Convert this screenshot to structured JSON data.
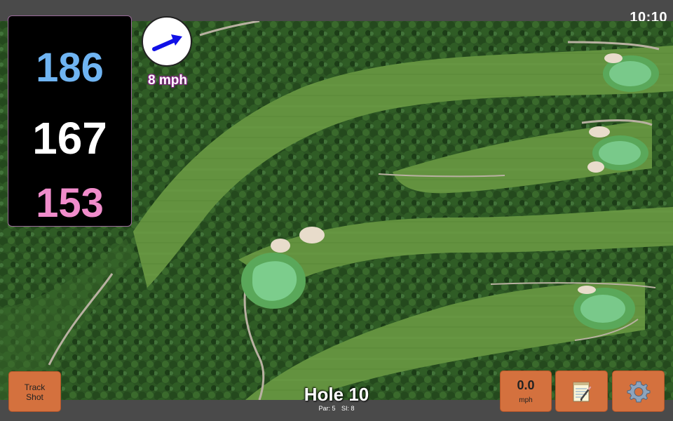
{
  "status": {
    "time": "10:10"
  },
  "distances": {
    "back": "186",
    "middle": "167",
    "front": "153"
  },
  "wind": {
    "speed_label": "8 mph",
    "icon": "wind-arrow-icon",
    "arrow_color": "#1010e6"
  },
  "buttons": {
    "track_shot_line1": "Track",
    "track_shot_line2": "Shot",
    "wind_value": "0.0",
    "wind_unit": "mph",
    "notes_icon": "notepad-icon",
    "settings_icon": "gear-icon"
  },
  "hole": {
    "title": "Hole 10",
    "par": "Par: 5",
    "si": "SI: 8"
  },
  "colors": {
    "button": "#d4713e",
    "distance_back": "#6fb4f2",
    "distance_middle": "#ffffff",
    "distance_front": "#f08ccb",
    "fairway": "#5f8f3c",
    "green": "#6cc27a",
    "bunker": "#e8dccb",
    "trees": "#234a1c"
  }
}
